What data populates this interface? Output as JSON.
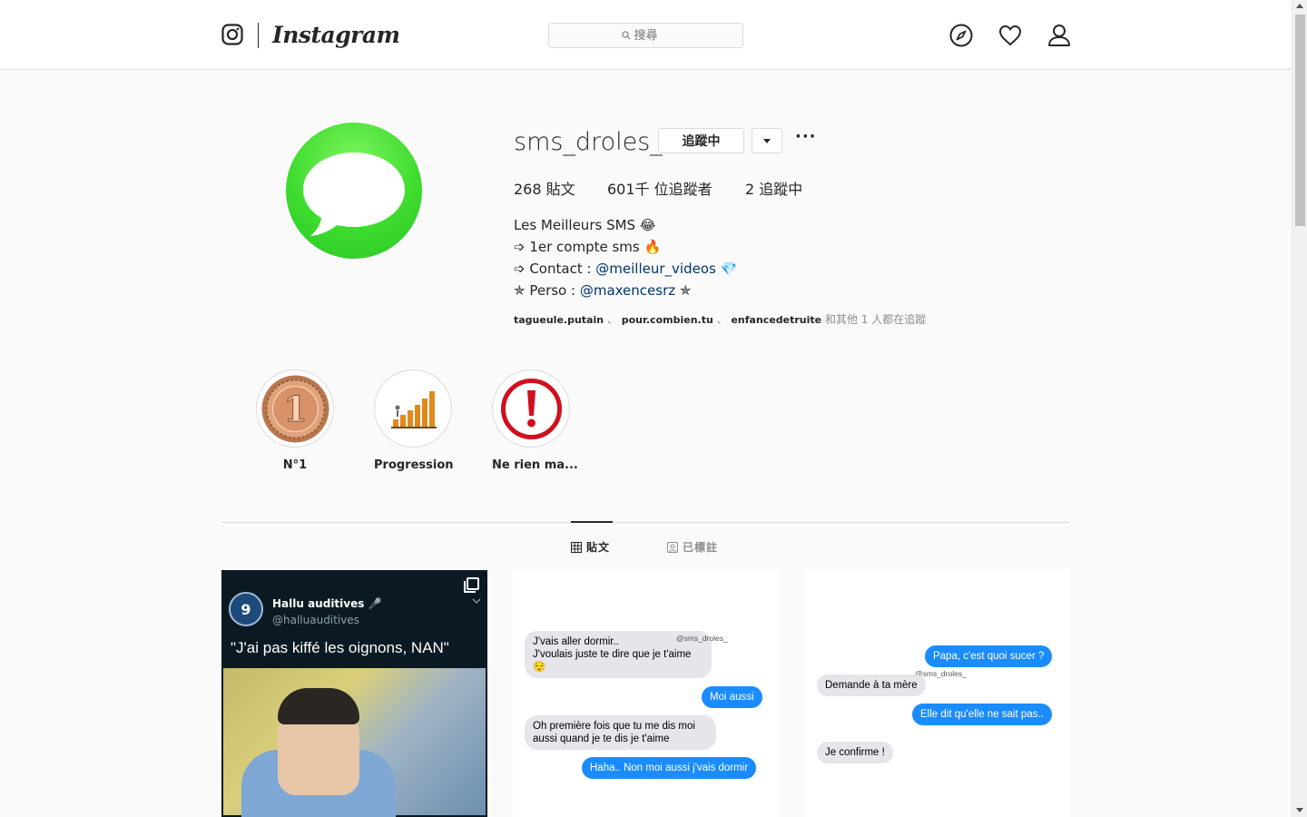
{
  "app": {
    "brand": "Instagram"
  },
  "search": {
    "placeholder": "搜尋"
  },
  "nav": {
    "icons": [
      "explore-icon",
      "activity-heart-icon",
      "profile-icon"
    ]
  },
  "profile": {
    "username": "sms_droles_",
    "follow_label": "追蹤中",
    "more_label": "···",
    "stats": {
      "posts_count": "268",
      "posts_label": "貼文",
      "followers_count": "601千",
      "followers_label": "位追蹤者",
      "following_count": "2",
      "following_label": "追蹤中"
    },
    "bio": {
      "name": "Les Meilleurs SMS 😂",
      "line1": "➩ 1er compte sms 🔥",
      "line2_prefix": "➩ Contact : ",
      "line2_link": "@meilleur_videos",
      "line2_suffix": " 💎",
      "line3_prefix": "✯ Perso : ",
      "line3_link": "@maxencesrz",
      "line3_suffix": " ✯"
    },
    "followed_by": {
      "acct1": "tagueule.putain",
      "acct2": "pour.combien.tu",
      "acct3": "enfancedetruite",
      "sep": "、",
      "suffix": " 和其他 1 人都在追蹤"
    }
  },
  "highlights": [
    {
      "label": "N°1",
      "icon": "medal-one-icon"
    },
    {
      "label": "Progression",
      "icon": "progression-chart-icon"
    },
    {
      "label": "Ne rien ma...",
      "icon": "exclamation-icon"
    }
  ],
  "tabs": [
    {
      "label": "貼文",
      "icon": "grid-icon",
      "active": true
    },
    {
      "label": "已標註",
      "icon": "tagged-icon",
      "active": false
    }
  ],
  "posts": {
    "post1": {
      "account_name": "Hallu auditives 🎤",
      "account_handle": "@halluauditives",
      "quote": "\"J'ai pas kiffé les oignons, NAN\""
    },
    "post2": {
      "watermark": "@sms_droles_",
      "msg1": "J'vais aller dormir..\nJ'voulais juste te dire que je t'aime\n😌",
      "msg2": "Moi aussi",
      "msg3": "Oh première fois que tu me dis moi\naussi quand je te dis je t'aime",
      "msg4": "Haha.. Non moi aussi j'vais dormir"
    },
    "post3": {
      "watermark": "@sms_droles_",
      "msg1": "Papa, c'est quoi sucer ?",
      "msg2": "Demande à ta mère",
      "msg3": "Elle dit qu'elle ne sait pas..",
      "msg4": "Je confirme !"
    }
  },
  "colors": {
    "link": "#00376b",
    "imessage_blue": "#1a8cff",
    "imessage_gray": "#e5e5ea",
    "avatar_green": "#3fdc2f"
  }
}
